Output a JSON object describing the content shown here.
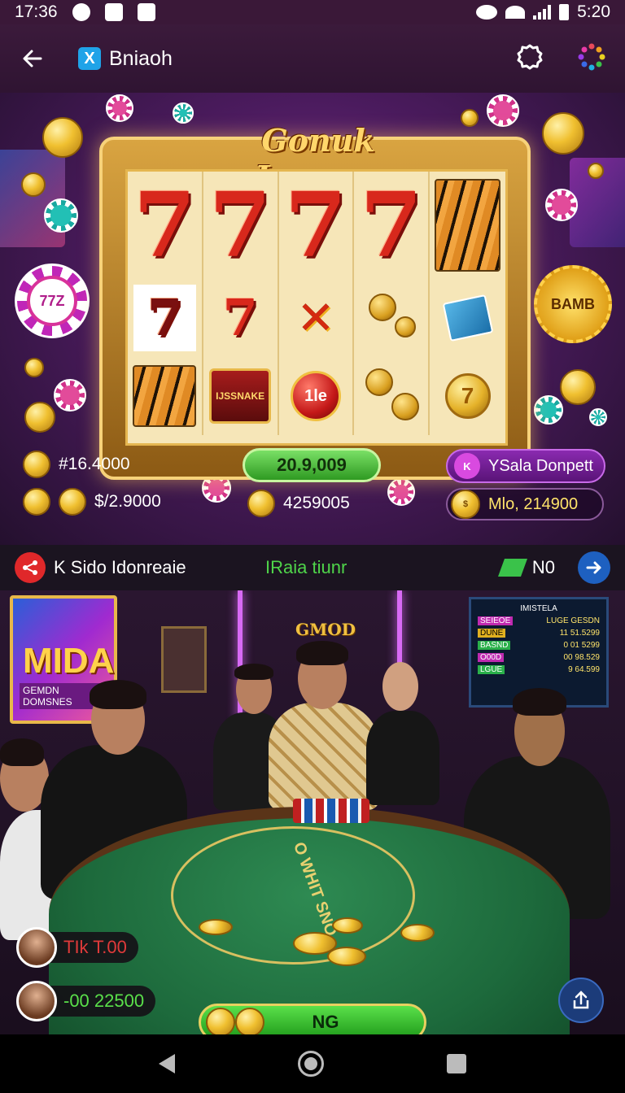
{
  "status_bar": {
    "time_left": "17:36",
    "time_right": "5:20"
  },
  "app_bar": {
    "title": "Bniaoh",
    "logo_glyph": "X",
    "icons": [
      "back-arrow-icon",
      "settings-icon",
      "apps-grid-icon"
    ]
  },
  "slot_banner": {
    "machine_title": "Gonuk Jomues",
    "left_badge": "77Z",
    "right_badge": "BAMB",
    "sticker_text": "IJSSNAKE",
    "ball_text": "1le",
    "coin_symbol": "7",
    "stats": {
      "balance_1": "#16.4000",
      "balance_2": "$/2.9000",
      "center_pill": "20.9,009",
      "center_value": "4259005",
      "player_pill": "YSala Donpett",
      "player_pill_avatar": "K",
      "win_pill": "Mlo, 214900",
      "win_coin": "$"
    },
    "accent_colors": {
      "green": "#2f9a22",
      "purple": "#8a2ab0",
      "gold": "#f0c030"
    }
  },
  "info_bar": {
    "left_text": "K Sido Idonreaie",
    "center_text": "IRaia tiunr",
    "right_text": "N0",
    "icons": [
      "share-icon",
      "diamond-icon",
      "arrow-right-icon"
    ]
  },
  "poker_scene": {
    "wall_screen_title": "MIDA",
    "wall_screen_subtitle": "GEMDN DOMSNES",
    "dealer_crown": "GMOD",
    "scoreboard": {
      "header": "IMISTELA",
      "rows": [
        {
          "tag": "SEIEOE",
          "val": "LUGE GESDN"
        },
        {
          "tag": "DUNE",
          "val": "11 51.5299"
        },
        {
          "tag": "BASND",
          "val": "0 01 5299"
        },
        {
          "tag": "O00D",
          "val": "00 98.529"
        },
        {
          "tag": "LGUE",
          "val": "9 64.599"
        }
      ]
    },
    "table_text": "O WHIT SNO",
    "players": [
      {
        "label": "TIk T.00",
        "color": "#e03a3a"
      },
      {
        "label": "-00 22500",
        "color": "#5ae04a"
      }
    ],
    "bet_bar_label": "NG"
  },
  "nav_bar": {
    "icons": [
      "nav-back-icon",
      "nav-home-icon",
      "nav-recent-icon"
    ]
  }
}
